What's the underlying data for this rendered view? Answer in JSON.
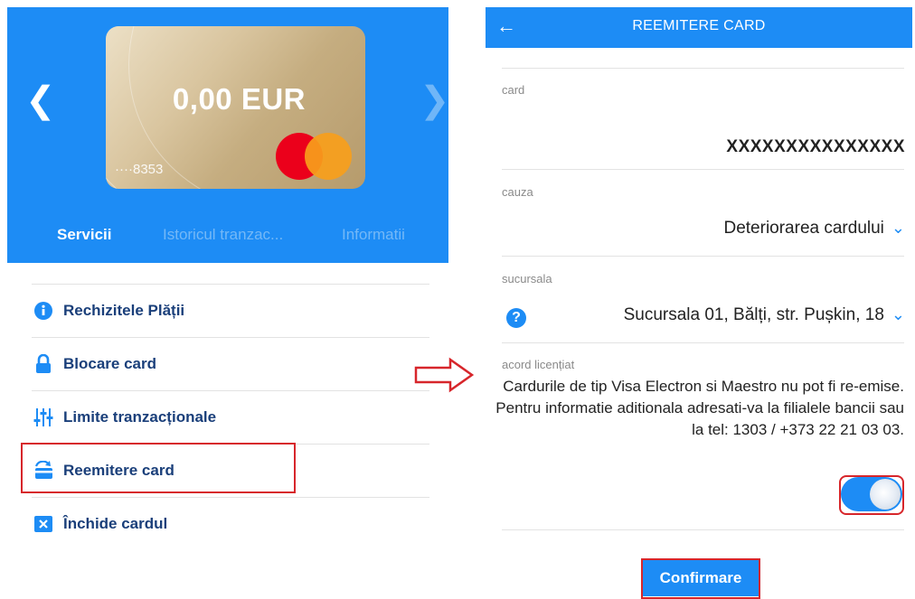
{
  "left": {
    "card": {
      "balance": "0,00 EUR",
      "number": "····8353",
      "brand_icon": "mastercard-logo"
    },
    "nav": {
      "prev_icon": "chevron-left-icon",
      "next_icon": "chevron-right-icon"
    },
    "tabs": [
      {
        "label": "Servicii",
        "active": true
      },
      {
        "label": "Istoricul tranzac...",
        "active": false
      },
      {
        "label": "Informatii",
        "active": false
      }
    ],
    "menu": [
      {
        "label": "Rechizitele Plății",
        "icon": "info-icon"
      },
      {
        "label": "Blocare card",
        "icon": "lock-icon"
      },
      {
        "label": "Limite tranzacționale",
        "icon": "sliders-icon"
      },
      {
        "label": "Reemitere card",
        "icon": "card-reissue-icon",
        "highlighted": true
      },
      {
        "label": "Închide cardul",
        "icon": "close-box-icon"
      }
    ]
  },
  "right": {
    "header": {
      "title": "REEMITERE CARD",
      "back_icon": "arrow-left-icon"
    },
    "fields": {
      "card": {
        "label": "card",
        "value": "XXXXXXXXXXXXXXX"
      },
      "cauza": {
        "label": "cauza",
        "value": "Deteriorarea cardului"
      },
      "sucursala": {
        "label": "sucursala",
        "value": "Sucursala 01, Bălți, str. Pușkin, 18"
      },
      "acord": {
        "label": "acord licențiat",
        "text": "Cardurile de tip Visa Electron si Maestro nu pot fi re-emise. Pentru informatie aditionala adresati-va la filialele bancii sau la tel: 1303 / +373 22 21 03 03.",
        "toggle_on": true
      }
    },
    "confirm_label": "Confirmare"
  },
  "colors": {
    "primary": "#1d8cf5",
    "highlight": "#d7262b",
    "menu_text": "#1a3f7a"
  }
}
